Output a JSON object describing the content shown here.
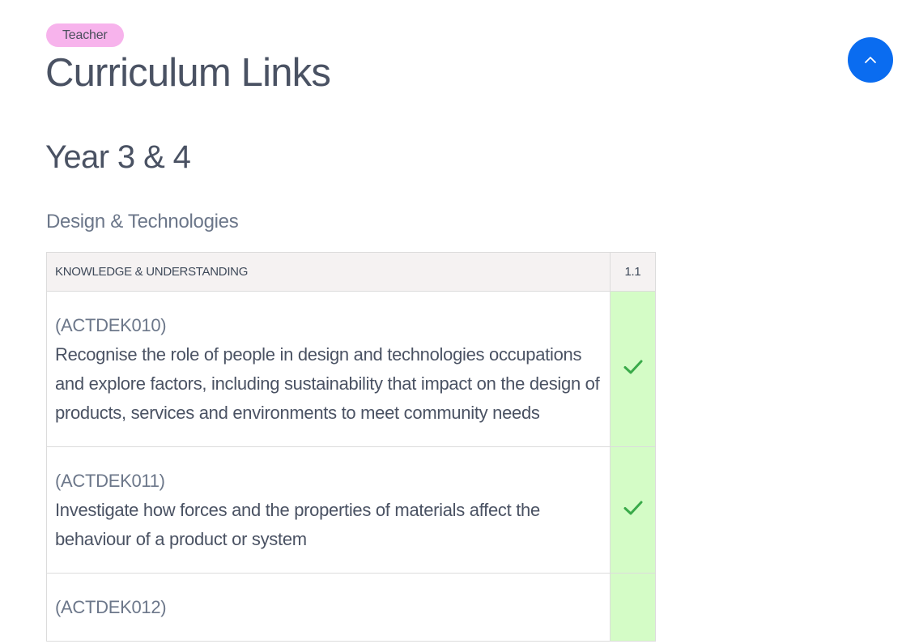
{
  "badge": {
    "label": "Teacher"
  },
  "page": {
    "title": "Curriculum Links"
  },
  "top_button": {
    "icon": "chevron-up-icon"
  },
  "section": {
    "title": "Year 3 & 4"
  },
  "subsection": {
    "title": "Design & Technologies"
  },
  "table": {
    "headers": [
      "KNOWLEDGE & UNDERSTANDING",
      "1.1"
    ],
    "rows": [
      {
        "code": "(ACTDEK010)",
        "text": "Recognise the role of people in design and technologies occupations and explore factors, including sustainability that impact on the design of products, services and environments to meet community needs",
        "checked": true
      },
      {
        "code": "(ACTDEK011)",
        "text": "Investigate how forces and the properties of materials affect the behaviour of a product or system",
        "checked": true
      },
      {
        "code": "(ACTDEK012)",
        "text": "",
        "checked": false
      }
    ]
  },
  "colors": {
    "badge_bg": "#f7b3ec",
    "accent": "#0a6cf0",
    "check_cell_bg": "#d4fcc6",
    "check_mark": "#3aaa4a",
    "header_bg": "#f5f2f2"
  }
}
